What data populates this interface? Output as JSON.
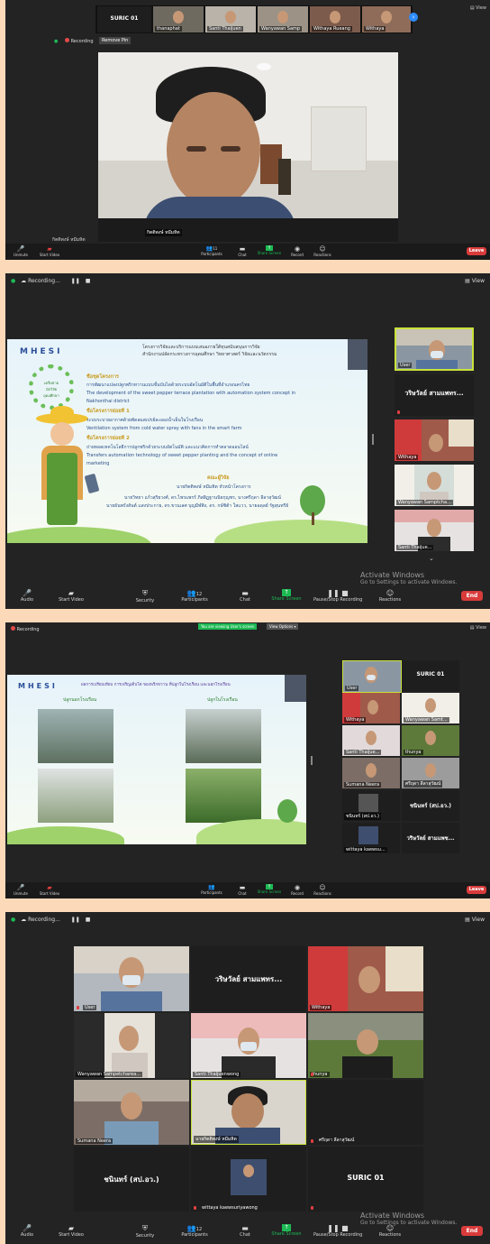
{
  "panel1": {
    "speaker_thumbs": [
      {
        "label": "SURIC 01",
        "kind": "name"
      },
      {
        "label": "thanaphat",
        "kind": "video"
      },
      {
        "label": "Santi Thaijuen",
        "kind": "video"
      },
      {
        "label": "Wanyawan Samp",
        "kind": "video"
      },
      {
        "label": "Withaya Rueang",
        "kind": "video"
      },
      {
        "label": "Withaya",
        "kind": "video"
      }
    ],
    "recording": "Recording",
    "remove_pin": "Remove Pin",
    "active_speaker_name": "กิตติพงษ์ หมีมหิต",
    "toolbar": {
      "unmute": "Unmute",
      "start_video": "Start Video",
      "participants": "Participants",
      "participants_count": "11",
      "chat": "Chat",
      "share_screen": "Share Screen",
      "record": "Record",
      "reactions": "Reactions",
      "leave": "Leave"
    }
  },
  "panel2": {
    "recording": "Recording...",
    "view": "View",
    "slide": {
      "logo": "MHESI",
      "header1": "โครงการวิจัยและบริการแบบเสนอภายใต้ทุนสนับสนุนการวิจัย",
      "header2": "สำนักงานปลัดกระทรวงการอุดมศึกษา วิทยาศาสตร์ วิจัยและนวัตกรรม",
      "t_program": "ชื่อชุดโครงการ",
      "program_th": "การพัฒนาแปลงปลูกพริกหวานแบบขั้นบันไดด้วยระบบอัตโนมัติในพื้นที่อำเภอนครไทย",
      "program_en1": "The development of the sweet pepper terrace plantation with automation  system concept in",
      "program_en2": "Nakhonthai district",
      "t_sub1": "ชื่อโครงการย่อยที่ 1",
      "sub1_th": "ระบบระบายอากาศด้วยพัดลมสเปรย์ละอองน้ำเย็นในโรงเรือน",
      "sub1_en": "Ventilation system  from cold water spray with fans in the smart farm",
      "t_sub2": "ชื่อโครงการย่อยที่ 2",
      "sub2_th": "ถ่ายทอดเทคโนโลยีการปลูกพริกด้วยระบบอัตโนมัติ และแนวคิดการทำตลาดออนไลน์",
      "sub2_en1": "Transfers automation technology of sweet pepper planting and the concept of online",
      "sub2_en2": "marketing",
      "team_title": "คณะผู้วิจัย",
      "leader": "นายกิตติพงษ์ หมีมหิต  หัวหน้าโครงการ",
      "members1": "นายวิทยา แก้วสุริยวงศ์, ดร.ไพรแพรร์ ภิสสิฏฐานนิยกุญชร, นางศรีฤดา ลีลาสุวัฒน์",
      "members2": "นายธันพรั่งสันต์ แสงประกาย, ดร.ขวนเลศ บุญมีฬพิง, ดร. กษ์ชิต้า ใสแวว, นายอดุลย์ รัฐสุนทรีย์",
      "wheel_caption": "เครือข่ายนักวิจัยอุดมศึกษา"
    },
    "side": [
      {
        "label": "User",
        "kind": "video",
        "muted": false,
        "active": true
      },
      {
        "label": "วริษวัลย์ สามแพทร...",
        "kind": "name",
        "muted": true
      },
      {
        "label": "Withaya",
        "kind": "video",
        "muted": false
      },
      {
        "label": "Wanyawan Samptcha...",
        "kind": "video",
        "muted": true
      },
      {
        "label": "Santi Thaijue...",
        "kind": "video",
        "muted": true
      }
    ],
    "watermark_title": "Activate Windows",
    "watermark_sub": "Go to Settings to activate Windows.",
    "toolbar": {
      "audio": "Audio",
      "start_video": "Start Video",
      "security": "Security",
      "participants": "Participants",
      "participants_count": "12",
      "chat": "Chat",
      "share_screen": "Share Screen",
      "pause_stop": "Pause/Stop Recording",
      "reactions": "Reactions",
      "end": "End"
    }
  },
  "panel3": {
    "recording": "Recording",
    "viewing_banner": "You are viewing User's screen",
    "view_options": "View Options ▾",
    "view": "View",
    "slide": {
      "logo": "MHESI",
      "title": "ผลการเปรียบเทียบ การเจริญเติบโต ของพริกหวาน ที่ปลูกในโรงเรือน และนอกโรงเรือน",
      "left_caption": "ปลูกนอกโรงเรือน",
      "right_caption": "ปลูกในโรงเรือน"
    },
    "grid": [
      {
        "label": "User",
        "kind": "video"
      },
      {
        "label": "SURIC 01",
        "kind": "name"
      },
      {
        "label": "Withaya",
        "kind": "video"
      },
      {
        "label": "Wanyawan Samt...",
        "kind": "video"
      },
      {
        "label": "Santi Thaijue...",
        "kind": "video"
      },
      {
        "label": "thunya",
        "kind": "video"
      },
      {
        "label": "Sumana Neera",
        "kind": "video"
      },
      {
        "label": "ศรีฤดา ลีลาสุวัฒน์",
        "kind": "video"
      },
      {
        "label": "ชนินทร์ (สป.อว.)",
        "kind": "name-small"
      },
      {
        "label": "วริษวัลย์ สามแพช...",
        "kind": "name-small"
      }
    ],
    "grid_small": [
      "ชนินทร์ (สป.อว.)",
      "wittaya kaewsu..."
    ],
    "toolbar": {
      "unmute": "Unmute",
      "start_video": "Start Video",
      "participants": "Participants",
      "chat": "Chat",
      "share_screen": "Share Screen",
      "record": "Record",
      "reactions": "Reactions",
      "leave": "Leave"
    }
  },
  "panel4": {
    "recording": "Recording...",
    "view": "View",
    "grid": [
      {
        "label": "User",
        "kind": "video",
        "muted": true
      },
      {
        "label": "วริษวัลย์ สามแพทร...",
        "kind": "name",
        "muted": false
      },
      {
        "label": "Withaya",
        "kind": "video",
        "muted": false
      },
      {
        "label": "Wanyawan Sampetcharea...",
        "kind": "video",
        "muted": false
      },
      {
        "label": "Santi Thaijuenwong",
        "kind": "video",
        "muted": false
      },
      {
        "label": "thunya",
        "kind": "video",
        "muted": true
      },
      {
        "label": "Sumana Neera",
        "kind": "video",
        "muted": false
      },
      {
        "label": "นายกิตติพงษ์ หมีมหิต",
        "kind": "video",
        "muted": false,
        "active": true
      },
      {
        "label": "ศรีฤดา ลีลาสุวัฒน์",
        "kind": "blank",
        "muted": true
      },
      {
        "label": "ชนินทร์ (สป.อว.)",
        "kind": "name",
        "muted": false
      },
      {
        "label": "wittaya kaewsuriyawong",
        "kind": "video",
        "muted": true
      },
      {
        "label": "SURIC 01",
        "kind": "name",
        "muted": true
      }
    ],
    "watermark_title": "Activate Windows",
    "watermark_sub": "Go to Settings to activate Windows.",
    "toolbar": {
      "audio": "Audio",
      "start_video": "Start Video",
      "security": "Security",
      "participants": "Participants",
      "participants_count": "12",
      "chat": "Chat",
      "share_screen": "Share Screen",
      "pause_stop": "Pause/Stop Recording",
      "reactions": "Reactions",
      "end": "End"
    }
  },
  "colors": {
    "background": "#fcd9b8",
    "panel": "#232323",
    "toolbar": "#1a1a1a",
    "end_red": "#d93b3b",
    "share_green": "#1db954",
    "active_border": "#c9e23a"
  }
}
